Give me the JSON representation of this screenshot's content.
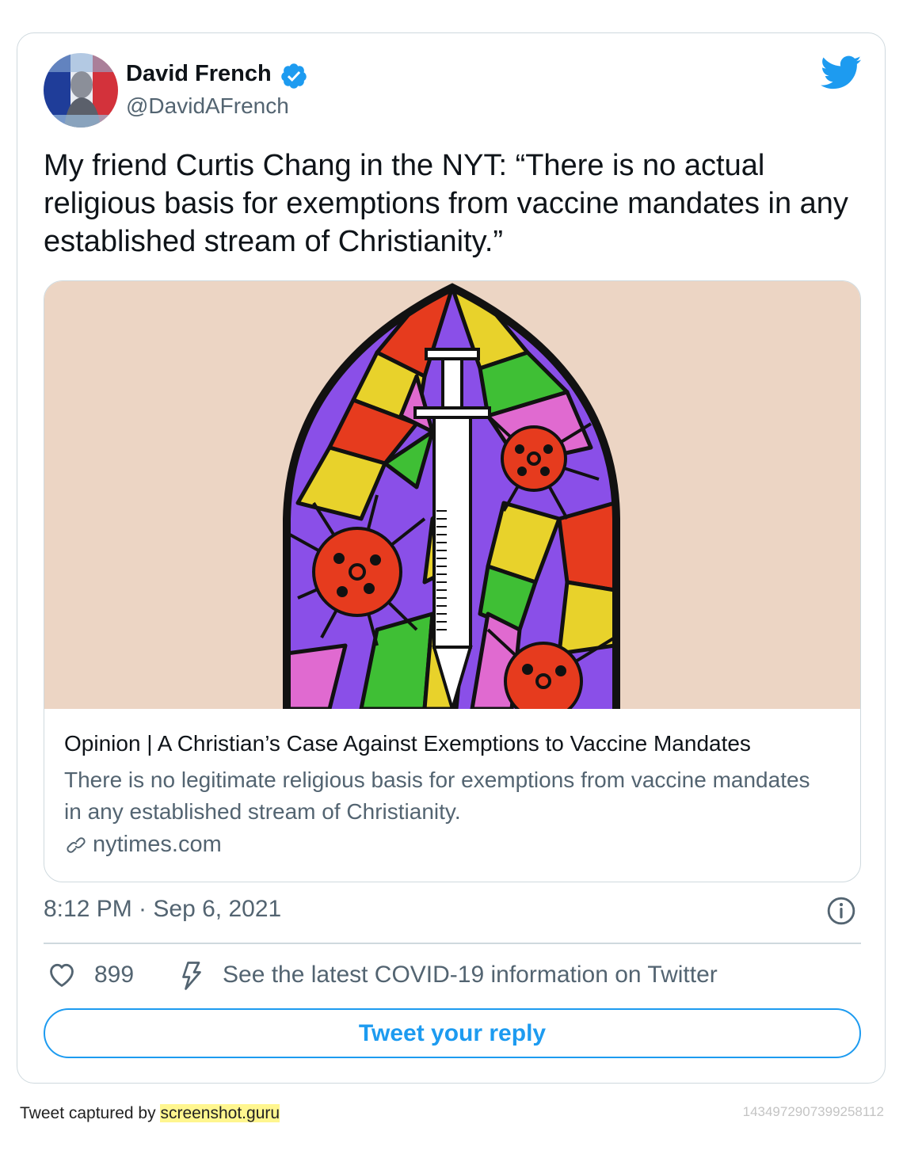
{
  "tweet": {
    "author_name": "David French",
    "author_handle": "@DavidAFrench",
    "verified": true,
    "text": "My friend Curtis Chang in the NYT: “There is no actual religious basis for exemptions from vaccine mandates in any established stream of Christianity.”",
    "timestamp": "8:12 PM · Sep 6, 2021",
    "likes": "899",
    "covid_notice": "See the latest COVID-19 information on Twitter",
    "reply_button": "Tweet your reply"
  },
  "link_card": {
    "title": "Opinion | A Christian’s Case Against Exemptions to Vaccine Mandates",
    "description": "There is no legitimate religious basis for exemptions from vaccine mandates in any established stream of Christianity.",
    "domain": "nytimes.com",
    "image": "stained-glass-window-with-syringe-and-virus-illustration"
  },
  "footer": {
    "captured_by_prefix": "Tweet captured by",
    "captured_by_site": "screenshot.guru",
    "tweet_id": "1434972907399258112"
  },
  "icons": {
    "verified": "verified-badge-icon",
    "brand": "twitter-bird-icon",
    "link": "link-icon",
    "info": "info-icon",
    "like": "heart-icon",
    "covid": "bolt-icon"
  },
  "colors": {
    "accent": "#1d9bf0",
    "secondary_text": "#536471",
    "border": "#cfd9de",
    "art_background": "#ecd5c4",
    "highlight": "#fff68f"
  }
}
